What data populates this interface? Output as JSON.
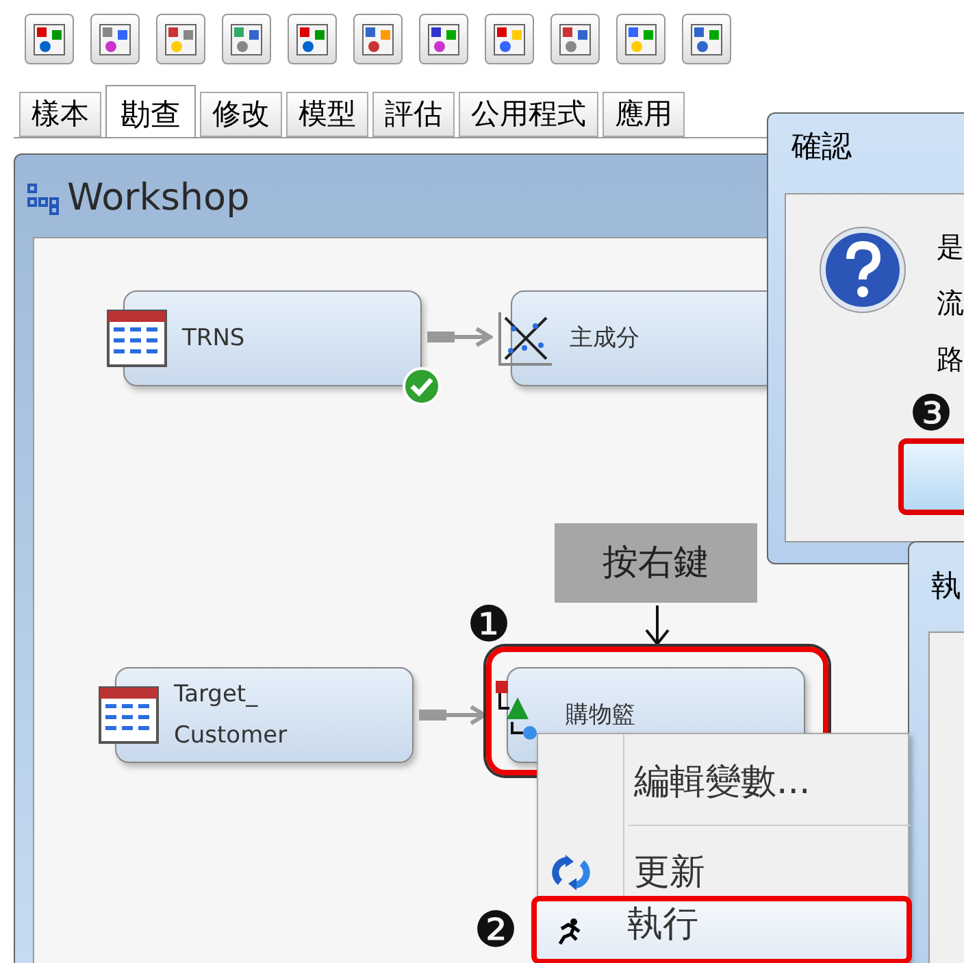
{
  "tabs": [
    {
      "label": "樣本",
      "selected": false
    },
    {
      "label": "勘查",
      "selected": true
    },
    {
      "label": "修改",
      "selected": false
    },
    {
      "label": "模型",
      "selected": false
    },
    {
      "label": "評估",
      "selected": false
    },
    {
      "label": "公用程式",
      "selected": false
    },
    {
      "label": "應用",
      "selected": false
    }
  ],
  "diagram": {
    "title": "Workshop",
    "nodes": [
      {
        "label": "TRNS",
        "kind": "data",
        "done": true
      },
      {
        "label": "主成分",
        "kind": "pca",
        "done": false
      },
      {
        "label": "Target_\nCustomer",
        "kind": "data",
        "done": false
      },
      {
        "label": "購物籃",
        "kind": "assoc",
        "done": false
      }
    ]
  },
  "callout": {
    "text": "按右鍵"
  },
  "steps": [
    "❶",
    "❷",
    "❸"
  ],
  "context_menu": [
    {
      "label": "編輯變數...",
      "selected": false
    },
    {
      "label": "更新",
      "selected": false
    },
    {
      "label": "執行",
      "selected": true
    }
  ],
  "confirm_dialog": {
    "title": "確認",
    "lines": [
      "是",
      "流",
      "路"
    ]
  },
  "run_dialog": {
    "title": "執"
  }
}
